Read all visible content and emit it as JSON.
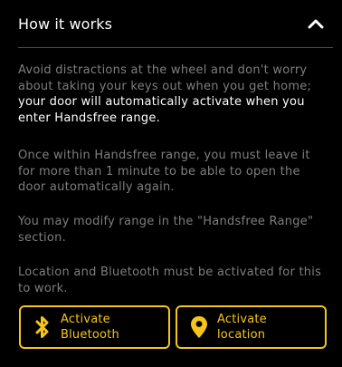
{
  "header": {
    "title": "How it works"
  },
  "paragraphs": {
    "p1_muted": "Avoid distractions at the wheel and don't worry about taking your keys out when you get home; ",
    "p1_highlight": "your door will automatically activate when you enter Handsfree range",
    "p1_end": ".",
    "p2": "Once within Handsfree range, you must leave it for more than 1 minute to be able to open the door automatically again.",
    "p3": "You may modify range in the \"Handsfree Range\" section.",
    "p4": "Location and Bluetooth must be activated for this to work."
  },
  "buttons": {
    "bluetooth_label": "Activate Bluetooth",
    "location_label": "Activate location"
  },
  "colors": {
    "accent": "#f5c518",
    "background": "#000000",
    "muted_text": "#7e7e7e",
    "text": "#ffffff"
  },
  "icons": {
    "collapse": "chevron-up-icon",
    "bluetooth": "bluetooth-icon",
    "location": "location-pin-icon"
  }
}
